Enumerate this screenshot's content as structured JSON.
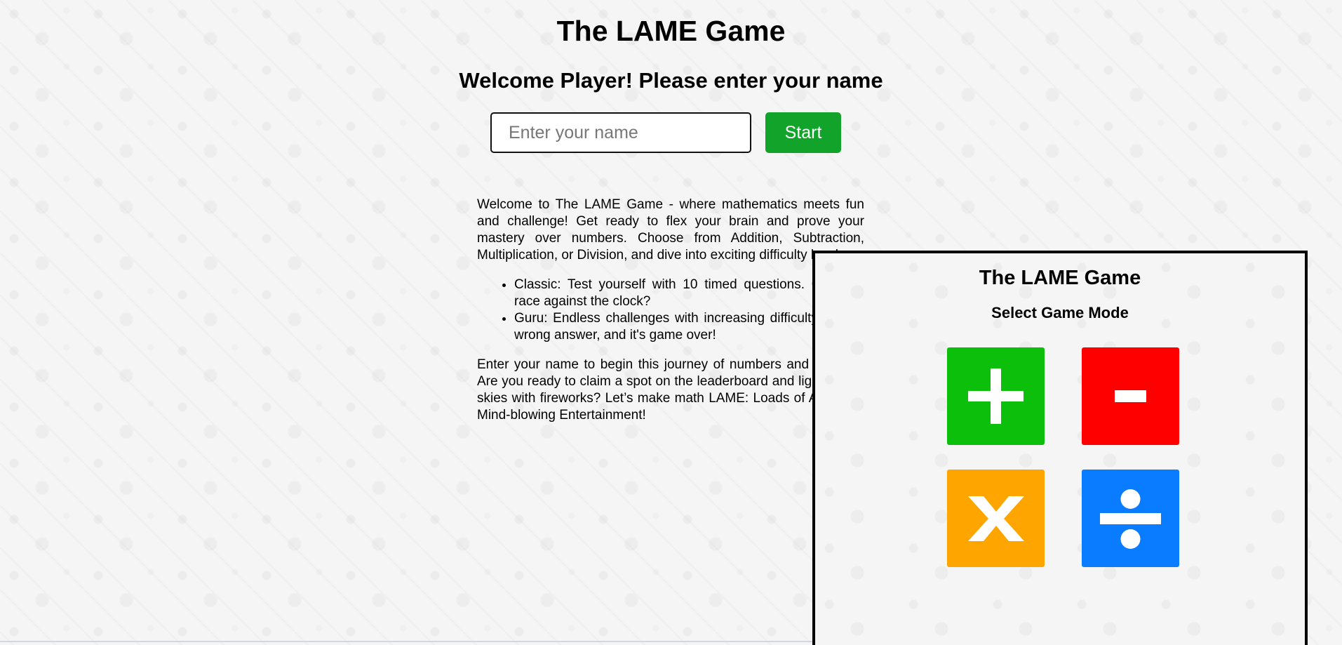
{
  "header": {
    "title": "The LAME Game",
    "welcome": "Welcome Player! Please enter your name"
  },
  "name_form": {
    "placeholder": "Enter your name",
    "value": "",
    "start_label": "Start"
  },
  "intro": {
    "paragraph1": "Welcome to The LAME Game - where mathematics meets fun and challenge! Get ready to flex your brain and prove your mastery over numbers. Choose from Addition, Subtraction, Multiplication, or Division, and dive into exciting difficulty levels:",
    "modes": [
      "Classic: Test yourself with 10 timed questions. Can you race against the clock?",
      "Guru: Endless challenges with increasing difficulty — one wrong answer, and it's game over!"
    ],
    "paragraph2": "Enter your name to begin this journey of numbers and strategy. Are you ready to claim a spot on the leaderboard and light up the skies with fireworks? Let’s make math LAME: Loads of Amazing, Mind-blowing Entertainment!"
  },
  "mode_panel": {
    "title": "The LAME Game",
    "subtitle": "Select Game Mode",
    "modes": [
      {
        "name": "addition",
        "icon": "plus-icon",
        "color": "#0bbf0b"
      },
      {
        "name": "subtraction",
        "icon": "minus-icon",
        "color": "#ff0000"
      },
      {
        "name": "multiplication",
        "icon": "times-icon",
        "color": "#ffa500"
      },
      {
        "name": "division",
        "icon": "divide-icon",
        "color": "#0a7cff"
      }
    ]
  }
}
